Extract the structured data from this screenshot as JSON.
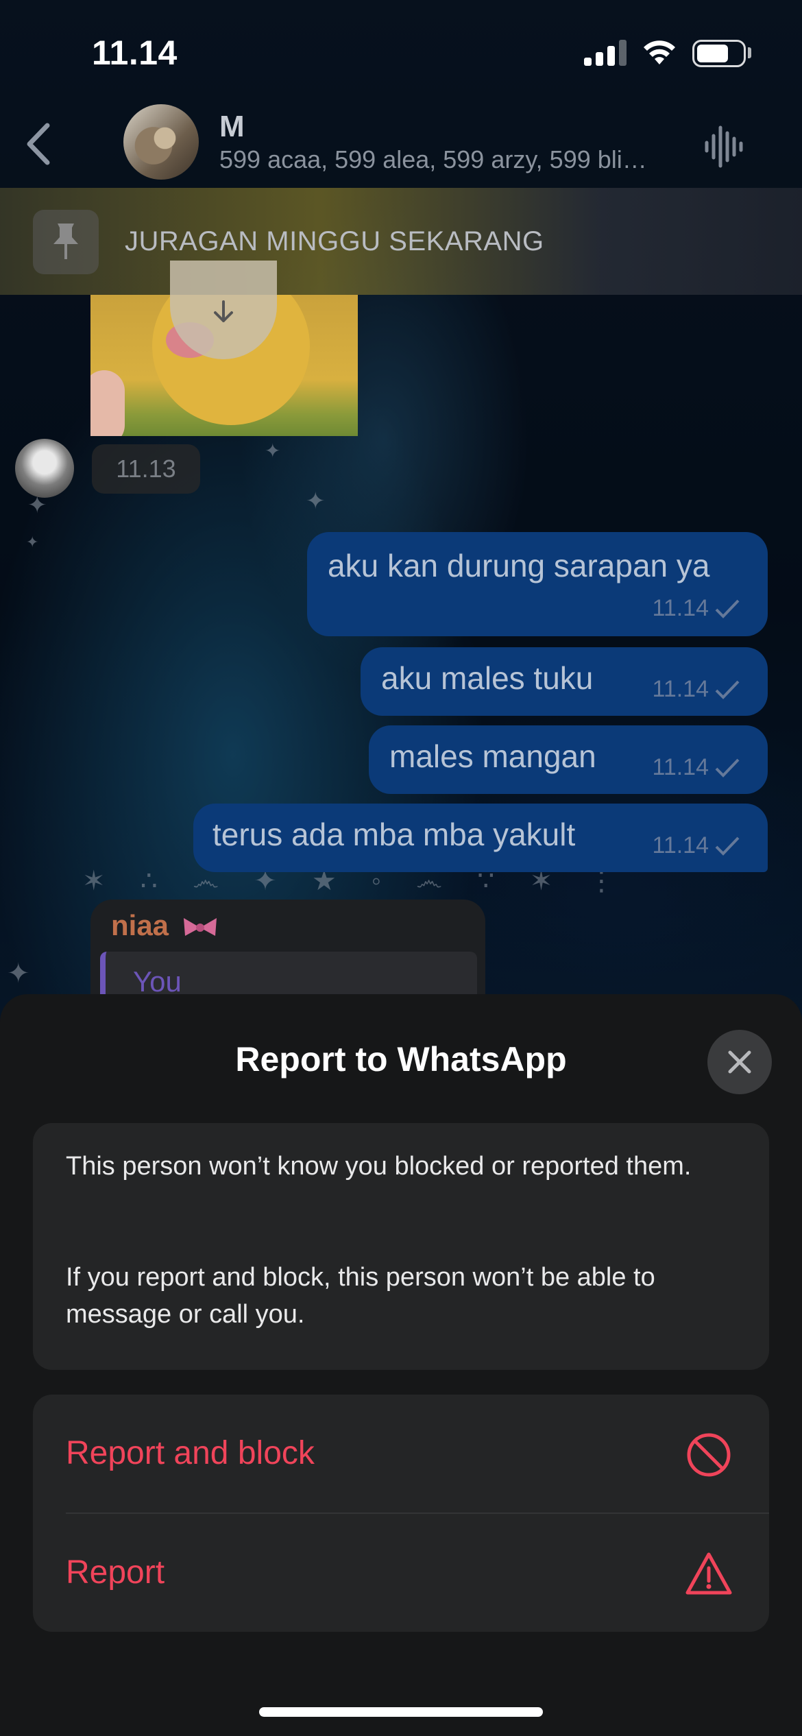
{
  "status_bar": {
    "time": "11.14",
    "signal_icon": "cellular-signal-icon",
    "wifi_icon": "wifi-icon",
    "battery_icon": "battery-icon",
    "battery_level": 0.7
  },
  "header": {
    "back_icon": "chevron-left-icon",
    "name": "M",
    "members": "599 acaa, 599 alea, 599 arzy, 599 bli…",
    "voice_icon": "voice-chat-icon"
  },
  "pinned": {
    "icon": "pin-icon",
    "text": "JURAGAN MINGGU SEKARANG"
  },
  "messages": {
    "incoming_media": {
      "time": "11.13",
      "download_icon": "arrow-down-icon"
    },
    "outgoing": [
      {
        "text": "aku kan durung sarapan ya",
        "time": "11.14"
      },
      {
        "text": "aku males tuku",
        "time": "11.14"
      },
      {
        "text": "males mangan",
        "time": "11.14"
      },
      {
        "text": "terus ada mba mba yakult",
        "time": "11.14"
      }
    ],
    "reply": {
      "sender": "niaa",
      "sender_emoji": "ribbon-icon",
      "quoted_name": "You"
    }
  },
  "sheet": {
    "title": "Report to WhatsApp",
    "close_icon": "close-icon",
    "info_p1": "This person won’t know you blocked or reported them.",
    "info_p2": "If you report and block, this person won’t be able to message or call you.",
    "actions": [
      {
        "label": "Report and block",
        "icon": "block-icon"
      },
      {
        "label": "Report",
        "icon": "warning-icon"
      }
    ],
    "accent_color": "#f0445a"
  }
}
